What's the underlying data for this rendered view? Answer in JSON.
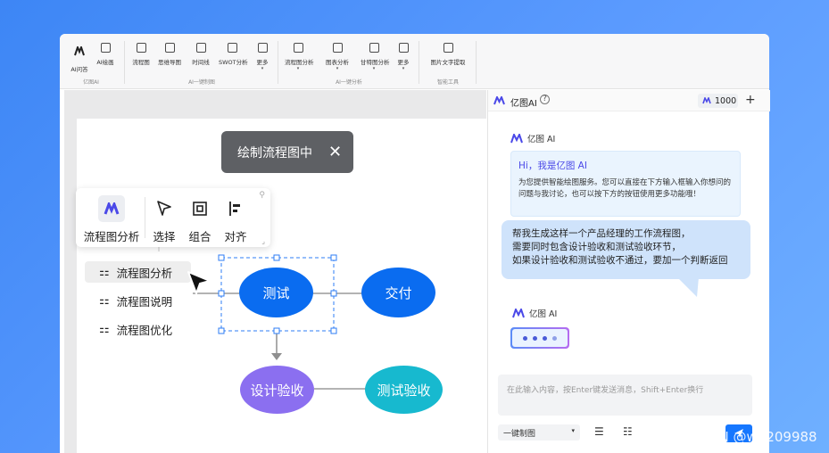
{
  "ribbon": {
    "groups": [
      {
        "label": "亿图AI",
        "buttons": [
          {
            "label": "AI问答"
          },
          {
            "label": "AI绘画"
          }
        ]
      },
      {
        "label": "AI一键制图",
        "buttons": [
          {
            "label": "流程图"
          },
          {
            "label": "思维导图"
          },
          {
            "label": "时间线"
          },
          {
            "label": "SWOT分析"
          },
          {
            "label": "更多",
            "dropdown": true
          }
        ]
      },
      {
        "label": "AI一键分析",
        "buttons": [
          {
            "label": "流程图分析",
            "dropdown": true
          },
          {
            "label": "图表分析",
            "dropdown": true
          },
          {
            "label": "甘特图分析",
            "dropdown": true
          },
          {
            "label": "更多",
            "dropdown": true
          }
        ]
      },
      {
        "label": "智能工具",
        "buttons": [
          {
            "label": "图片文字提取"
          }
        ]
      }
    ]
  },
  "canvas": {
    "toast": {
      "text": "绘制流程图中",
      "close_icon": "close-icon"
    },
    "floating_toolbar": {
      "items": [
        {
          "label": "流程图分析",
          "icon": "edraw-ai-logo-icon"
        },
        {
          "label": "选择",
          "icon": "cursor-icon"
        },
        {
          "label": "组合",
          "icon": "group-icon"
        },
        {
          "label": "对齐",
          "icon": "align-icon"
        }
      ]
    },
    "analysis_menu": [
      {
        "label": "流程图分析",
        "active": true
      },
      {
        "label": "流程图说明"
      },
      {
        "label": "流程图优化"
      }
    ],
    "nodes": {
      "test": "测试",
      "deliver": "交付",
      "design_check": "设计验收",
      "test_check": "测试验收"
    },
    "colors": {
      "blue": "#0a6cf0",
      "purple": "#8b6ff0",
      "cyan": "#17b9cf"
    }
  },
  "panel": {
    "title": "亿图AI",
    "credits": "1000",
    "ai_name": "亿图 AI",
    "greeting": "Hi，我是亿图 AI",
    "intro": "为您提供智能绘图服务。您可以直接在下方输入框输入你想问的问题与我讨论，也可以按下方的按钮使用更多功能哦！",
    "user_message": [
      "帮我生成这样一个产品经理的工作流程图，",
      "需要同时包含设计验收和测试验收环节，",
      "如果设计验收和测试验收不通过，要加一个判断返回"
    ],
    "ai_name_2": "亿图 AI",
    "input_placeholder": "在此输入内容，按Enter键发送消息，Shift+Enter换行",
    "mode_select": "一键制图"
  },
  "watermark": "CSDN @wd209988"
}
